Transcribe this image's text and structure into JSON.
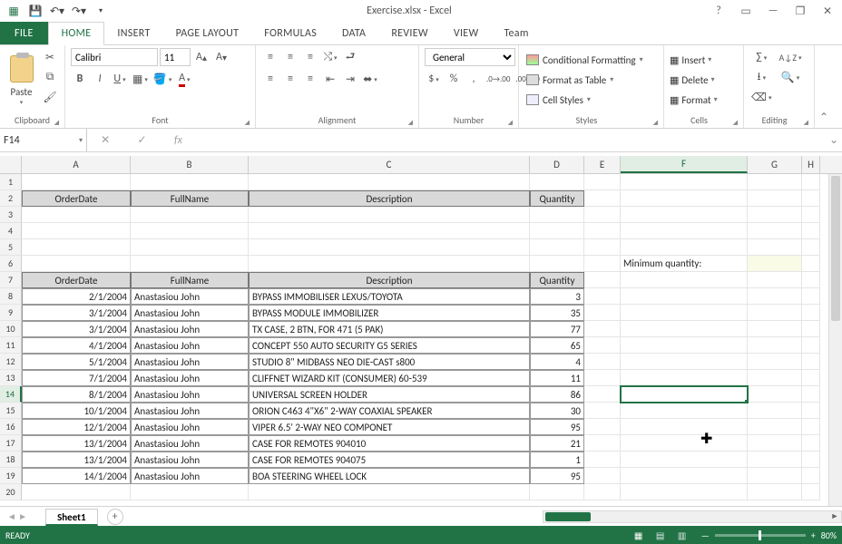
{
  "title": "Exercise.xlsx - Excel",
  "tabs": {
    "file": "FILE",
    "home": "HOME",
    "insert": "INSERT",
    "pagelayout": "PAGE LAYOUT",
    "formulas": "FORMULAS",
    "data": "DATA",
    "review": "REVIEW",
    "view": "VIEW",
    "team": "Team"
  },
  "ribbon": {
    "clipboard": "Clipboard",
    "paste": "Paste",
    "font": "Font",
    "font_name": "Calibri",
    "font_size": "11",
    "alignment": "Alignment",
    "number": "Number",
    "number_format": "General",
    "styles": "Styles",
    "cond": "Conditional Formatting",
    "ftable": "Format as Table",
    "cstyles": "Cell Styles",
    "cells": "Cells",
    "insert": "Insert",
    "delete": "Delete",
    "format": "Format",
    "editing": "Editing"
  },
  "namebox": "F14",
  "columns": [
    "A",
    "B",
    "C",
    "D",
    "E",
    "F",
    "G",
    "H"
  ],
  "row2": {
    "A": "OrderDate",
    "B": "FullName",
    "C": "Description",
    "D": "Quantity"
  },
  "row6": {
    "F": "Minimum quantity:"
  },
  "row7": {
    "A": "OrderDate",
    "B": "FullName",
    "C": "Description",
    "D": "Quantity"
  },
  "data_rows": [
    {
      "n": 8,
      "A": "2/1/2004",
      "B": "Anastasiou John",
      "C": "BYPASS IMMOBILISER LEXUS/TOYOTA",
      "D": "3"
    },
    {
      "n": 9,
      "A": "3/1/2004",
      "B": "Anastasiou John",
      "C": "BYPASS MODULE  IMMOBILIZER",
      "D": "35"
    },
    {
      "n": 10,
      "A": "3/1/2004",
      "B": "Anastasiou John",
      "C": "TX CASE, 2 BTN, FOR 471 (5 PAK)",
      "D": "77"
    },
    {
      "n": 11,
      "A": "4/1/2004",
      "B": "Anastasiou John",
      "C": "CONCEPT 550 AUTO SECURITY G5 SERIES",
      "D": "65"
    },
    {
      "n": 12,
      "A": "5/1/2004",
      "B": "Anastasiou John",
      "C": "STUDIO 8\" MIDBASS NEO DIE-CAST s800",
      "D": "4"
    },
    {
      "n": 13,
      "A": "7/1/2004",
      "B": "Anastasiou John",
      "C": "CLIFFNET WIZARD KIT (CONSUMER) 60-539",
      "D": "11"
    },
    {
      "n": 14,
      "A": "8/1/2004",
      "B": "Anastasiou John",
      "C": "UNIVERSAL SCREEN HOLDER",
      "D": "86"
    },
    {
      "n": 15,
      "A": "10/1/2004",
      "B": "Anastasiou John",
      "C": "ORION C463 4\"X6\" 2-WAY COAXIAL SPEAKER",
      "D": "30"
    },
    {
      "n": 16,
      "A": "12/1/2004",
      "B": "Anastasiou John",
      "C": "VIPER  6.5' 2-WAY NEO COMPONET",
      "D": "95"
    },
    {
      "n": 17,
      "A": "13/1/2004",
      "B": "Anastasiou John",
      "C": "CASE FOR REMOTES 904010",
      "D": "21"
    },
    {
      "n": 18,
      "A": "13/1/2004",
      "B": "Anastasiou John",
      "C": "CASE FOR REMOTES 904075",
      "D": "1"
    },
    {
      "n": 19,
      "A": "14/1/2004",
      "B": "Anastasiou John",
      "C": "BOA STEERING WHEEL LOCK",
      "D": "95"
    }
  ],
  "sheet_tab": "Sheet1",
  "status": "READY",
  "zoom": "80%"
}
